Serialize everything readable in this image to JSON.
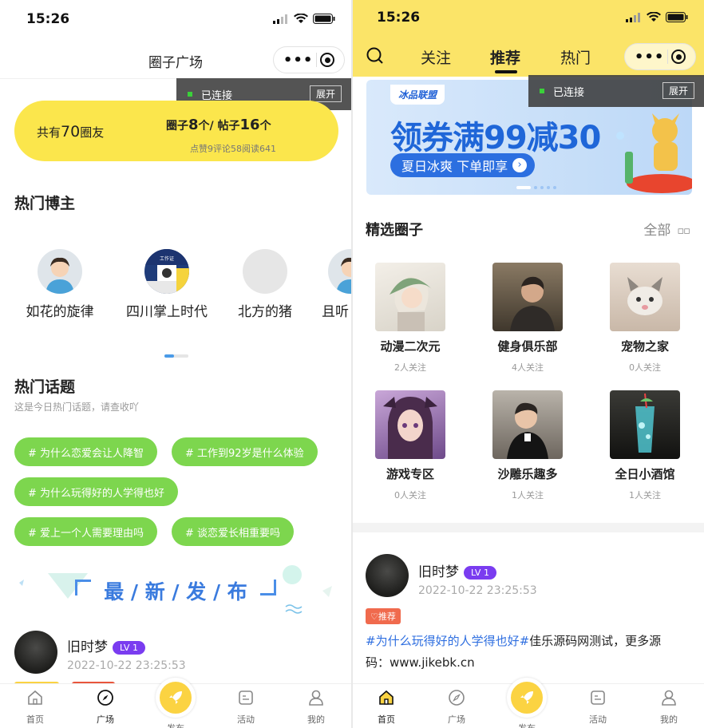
{
  "status": {
    "time_left": "15:26",
    "time_right": "15:26"
  },
  "left": {
    "title": "圈子广场",
    "connection": {
      "text": "已连接",
      "expand": "展开"
    },
    "summary": {
      "friends_prefix": "共有",
      "friends_count": "70",
      "friends_suffix": "圈友",
      "circles_label": "圈子",
      "circles_count": "8",
      "circles_unit": "个/",
      "posts_label": " 帖子",
      "posts_count": "16",
      "posts_unit": "个",
      "stats": "点赞9评论58阅读641"
    },
    "hot_bloggers_title": "热门博主",
    "bloggers": [
      {
        "name": "如花的旋律"
      },
      {
        "name": "四川掌上时代"
      },
      {
        "name": "北方的猪"
      },
      {
        "name": "且听"
      }
    ],
    "hot_topics_title": "热门话题",
    "hot_topics_subtitle": "这是今日热门话题，请查收吖",
    "topics": [
      "# 为什么恋爱会让人降智",
      "# 工作到92岁是什么体验",
      "# 为什么玩得好的人学得也好",
      "# 爱上一个人需要理由吗",
      "# 谈恋爱长相重要吗"
    ],
    "latest_title": "最 / 新 / 发 / 布",
    "post": {
      "user": "旧时梦",
      "level": "LV 1",
      "time": "2022-10-22 23:25:53"
    }
  },
  "right": {
    "tabs": [
      "关注",
      "推荐",
      "热门"
    ],
    "active_tab": "推荐",
    "connection": {
      "text": "已连接",
      "expand": "展开"
    },
    "banner": {
      "brand": "冰品联盟",
      "headline": "领券满99减30",
      "sub": "夏日冰爽 下单即享"
    },
    "featured_title": "精选圈子",
    "all_label": "全部",
    "circles": [
      {
        "name": "动漫二次元",
        "followers": "2人关注"
      },
      {
        "name": "健身俱乐部",
        "followers": "4人关注"
      },
      {
        "name": "宠物之家",
        "followers": "0人关注"
      },
      {
        "name": "游戏专区",
        "followers": "0人关注"
      },
      {
        "name": "沙雕乐趣多",
        "followers": "1人关注"
      },
      {
        "name": "全日小酒馆",
        "followers": "1人关注"
      }
    ],
    "post": {
      "user": "旧时梦",
      "level": "LV 1",
      "time": "2022-10-22 23:25:53",
      "tag": "推荐",
      "topic": "#为什么玩得好的人学得也好#",
      "content": "佳乐源码网测试，更多源码：www.jikebk.cn"
    }
  },
  "tabbar": {
    "home": "首页",
    "plaza": "广场",
    "publish": "发布",
    "activity": "活动",
    "mine": "我的"
  },
  "colors": {
    "yellow": "#fbe64c",
    "green": "#7dd64e",
    "purple": "#7a3cf0",
    "blue": "#2f6fe0"
  }
}
